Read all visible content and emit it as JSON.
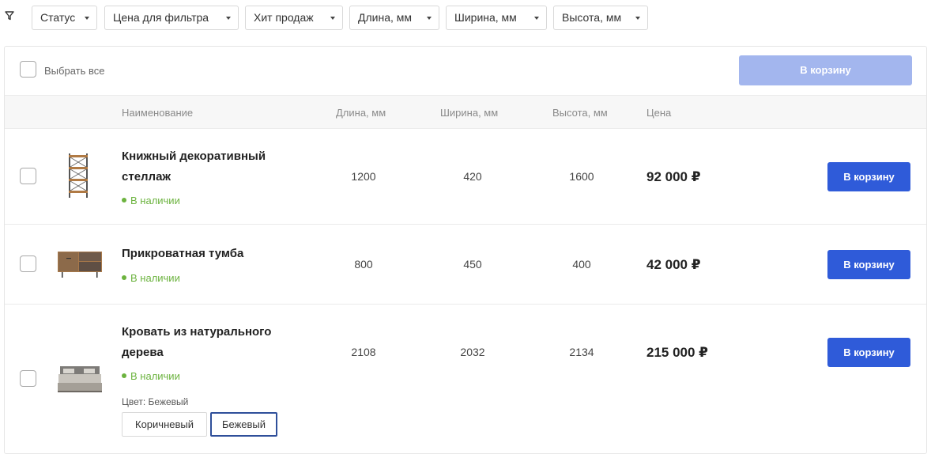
{
  "filters": [
    {
      "label": "Статус"
    },
    {
      "label": "Цена для фильтра"
    },
    {
      "label": "Хит продаж"
    },
    {
      "label": "Длина, мм"
    },
    {
      "label": "Ширина, мм"
    },
    {
      "label": "Высота, мм"
    }
  ],
  "toolbar": {
    "select_all_label": "Выбрать все",
    "add_all_button": "В корзину"
  },
  "columns": {
    "name": "Наименование",
    "length": "Длина, мм",
    "width": "Ширина, мм",
    "height": "Высота, мм",
    "price": "Цена"
  },
  "products": [
    {
      "name": "Книжный декоративный стеллаж",
      "stock": "В наличии",
      "length": "1200",
      "width": "420",
      "height": "1600",
      "price": "92 000 ₽",
      "button": "В корзину"
    },
    {
      "name": "Прикроватная тумба",
      "stock": "В наличии",
      "length": "800",
      "width": "450",
      "height": "400",
      "price": "42 000 ₽",
      "button": "В корзину"
    },
    {
      "name": "Кровать из натурального дерева",
      "stock": "В наличии",
      "length": "2108",
      "width": "2032",
      "height": "2134",
      "price": "215 000 ₽",
      "button": "В корзину",
      "color_label": "Цвет: Бежевый",
      "color_options": [
        "Коричневый",
        "Бежевый"
      ],
      "selected_color": "Бежевый"
    }
  ],
  "colors": {
    "primary": "#2f5bd9",
    "primary_disabled": "#a3b6ee",
    "in_stock": "#6cb33f",
    "selected_border": "#2f4f9a"
  }
}
